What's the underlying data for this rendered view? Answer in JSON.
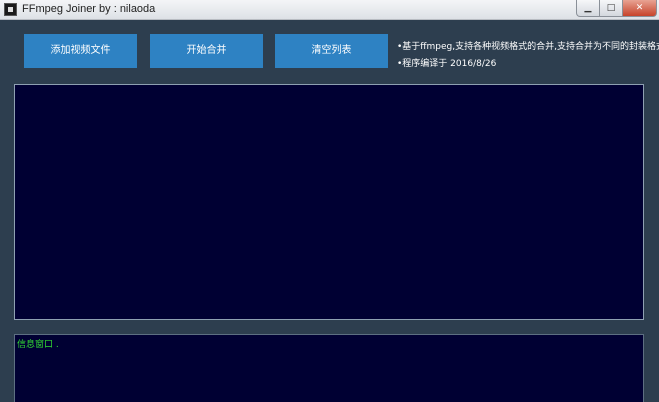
{
  "window": {
    "title": "FFmpeg Joiner  by : nilaoda",
    "minimize_glyph": "▁",
    "maximize_glyph": "□",
    "close_glyph": "✕",
    "icon": "app-icon"
  },
  "toolbar": {
    "add_label": "添加视频文件",
    "merge_label": "开始合并",
    "clear_label": "清空列表"
  },
  "info": {
    "line1": "•基于ffmpeg,支持各种视频格式的合并,支持合并为不同的封装格式",
    "line2": "•程序编译于 2016/8/26"
  },
  "log": {
    "title": "信息窗口  ."
  },
  "colors": {
    "background": "#2d3e4f",
    "button": "#2e82c3",
    "panel": "#000033",
    "log_text": "#33dd33"
  }
}
